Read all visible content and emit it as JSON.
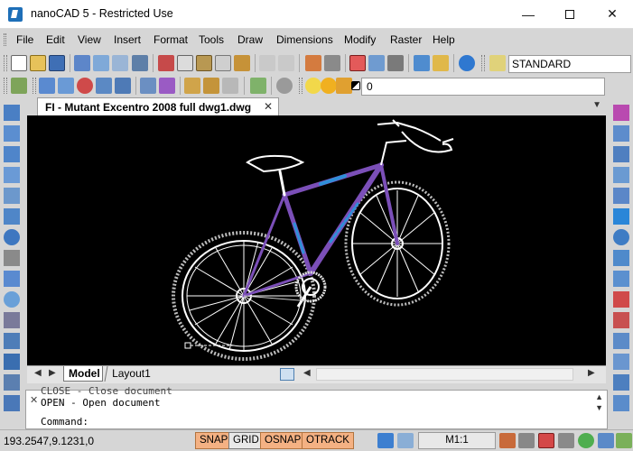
{
  "window": {
    "title": "nanoCAD 5 - Restricted Use",
    "minimize": "—",
    "close": "✕"
  },
  "menu": [
    "File",
    "Edit",
    "View",
    "Insert",
    "Format",
    "Tools",
    "Draw",
    "Dimensions",
    "Modify",
    "Raster",
    "Help"
  ],
  "toolbar": {
    "text_style": "STANDARD",
    "current_layer": "0"
  },
  "document": {
    "tab_title": "FI - Mutant Excentro 2008 full dwg1.dwg",
    "tab_close": "✕"
  },
  "layout_tabs": {
    "model": "Model",
    "layout1": "Layout1"
  },
  "command": {
    "line1": "CLOSE - Close document",
    "line2": "OPEN - Open document",
    "prompt": "Command:"
  },
  "status": {
    "coordinates": "193.2547,9.1231,0",
    "snap": "SNAP",
    "grid": "GRID",
    "osnap": "OSNAP",
    "otrack": "OTRACK",
    "scale": "M1:1"
  },
  "colors": {
    "canvas_bg": "#000000",
    "frame_purple": "#7b4fb8",
    "frame_blue": "#2f8fd8",
    "status_on": "#f4b183"
  }
}
